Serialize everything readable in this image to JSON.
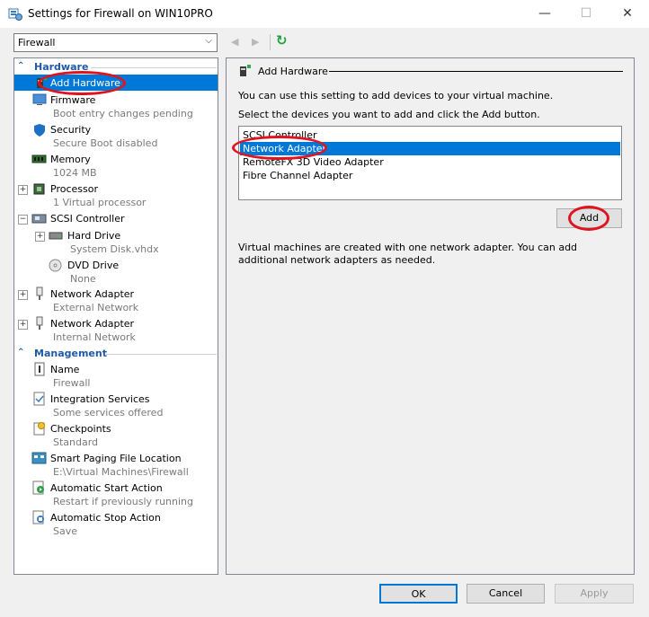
{
  "window": {
    "title": "Settings for Firewall on WIN10PRO",
    "minimize_glyph": "—",
    "maximize_glyph": "☐",
    "close_glyph": "✕"
  },
  "vm_selector": {
    "value": "Firewall"
  },
  "nav": {
    "back_glyph": "◀",
    "forward_glyph": "▶",
    "refresh_glyph": "↻"
  },
  "sections": {
    "hardware": "Hardware",
    "management": "Management"
  },
  "hardware_items": [
    {
      "label": "Add Hardware",
      "sub": ""
    },
    {
      "label": "Firmware",
      "sub": "Boot entry changes pending"
    },
    {
      "label": "Security",
      "sub": "Secure Boot disabled"
    },
    {
      "label": "Memory",
      "sub": "1024 MB"
    },
    {
      "label": "Processor",
      "sub": "1 Virtual processor"
    },
    {
      "label": "SCSI Controller",
      "sub": ""
    },
    {
      "label": "Hard Drive",
      "sub": "System Disk.vhdx"
    },
    {
      "label": "DVD Drive",
      "sub": "None"
    },
    {
      "label": "Network Adapter",
      "sub": "External Network"
    },
    {
      "label": "Network Adapter",
      "sub": "Internal Network"
    }
  ],
  "management_items": [
    {
      "label": "Name",
      "sub": "Firewall"
    },
    {
      "label": "Integration Services",
      "sub": "Some services offered"
    },
    {
      "label": "Checkpoints",
      "sub": "Standard"
    },
    {
      "label": "Smart Paging File Location",
      "sub": "E:\\Virtual Machines\\Firewall"
    },
    {
      "label": "Automatic Start Action",
      "sub": "Restart if previously running"
    },
    {
      "label": "Automatic Stop Action",
      "sub": "Save"
    }
  ],
  "panel": {
    "heading": "Add Hardware",
    "intro": "You can use this setting to add devices to your virtual machine.",
    "instruction": "Select the devices you want to add and click the Add button.",
    "devices": [
      "SCSI Controller",
      "Network Adapter",
      "RemoteFX 3D Video Adapter",
      "Fibre Channel Adapter"
    ],
    "selected_device": "Network Adapter",
    "add_label": "Add",
    "note": "Virtual machines are created with one network adapter. You can add additional network adapters as needed."
  },
  "footer": {
    "ok": "OK",
    "cancel": "Cancel",
    "apply": "Apply"
  },
  "colors": {
    "selection": "#0078d7",
    "section": "#1e5aa8",
    "annotation": "#e0141e",
    "refresh": "#1fa33a"
  }
}
